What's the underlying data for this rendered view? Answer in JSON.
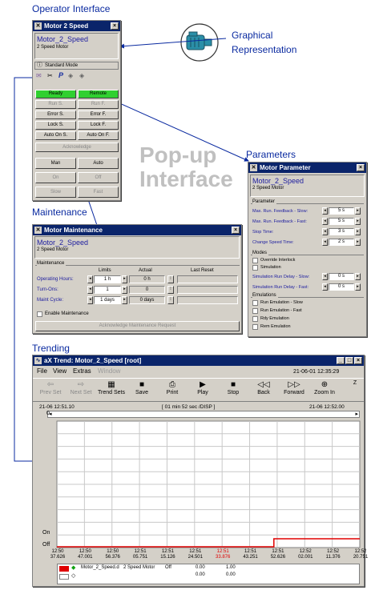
{
  "labels": {
    "operator_interface": "Operator Interface",
    "graphical_representation_1": "Graphical",
    "graphical_representation_2": "Representation",
    "parameters": "Parameters",
    "popup_1": "Pop-up",
    "popup_2": "Interface",
    "maintenance": "Maintenance",
    "trending": "Trending"
  },
  "motor2": {
    "title": "Motor 2 Speed",
    "name": "Motor_2_Speed",
    "desc": "2 Speed Motor",
    "mode": "Standard Mode",
    "toolbar_p": "P",
    "ready": "Ready",
    "remote": "Remote",
    "run_s": "Run S.",
    "run_f": "Run F.",
    "error_s": "Error S.",
    "error_f": "Error F.",
    "lock_s": "Lock S.",
    "lock_f": "Lock F.",
    "auto_on_s": "Auto On S.",
    "auto_on_f": "Auto On F.",
    "acknowledge": "Acknowledge",
    "man": "Man",
    "auto": "Auto",
    "on": "On",
    "off": "Off",
    "slow": "Slow",
    "fast": "Fast"
  },
  "params": {
    "title": "Motor Parameter",
    "name": "Motor_2_Speed",
    "desc": "2 Speed Motor",
    "group_parameter": "Parameter",
    "rows": [
      {
        "label": "Max. Run. Feedback - Slow:",
        "value": "5 s"
      },
      {
        "label": "Max. Run. Feedback - Fast:",
        "value": "5 s"
      },
      {
        "label": "Stop Time:",
        "value": "3 s"
      },
      {
        "label": "Change Speed Time:",
        "value": "2 s"
      }
    ],
    "group_modes": "Modes",
    "mode_items": [
      "Override Interlock",
      "Simulation"
    ],
    "sim_rows": [
      {
        "label": "Simulation Run Delay - Slow:",
        "value": "0 s"
      },
      {
        "label": "Simulation Run Delay - Fast:",
        "value": "0 s"
      }
    ],
    "group_emulations": "Emulations",
    "emu_items": [
      "Run Emulation - Slow",
      "Run Emulation - Fast",
      "Rdy Emulation",
      "Rem Emulation"
    ]
  },
  "maint": {
    "title": "Motor Maintenance",
    "name": "Motor_2_Speed",
    "desc": "2 Speed Motor",
    "group": "Maintenance",
    "col_limits": "Limits",
    "col_actual": "Actual",
    "col_last_reset": "Last Reset",
    "rows": [
      {
        "label": "Operating Hours:",
        "limit": "1 h",
        "actual": "0 h"
      },
      {
        "label": "Turn-Ons:",
        "limit": "1",
        "actual": "0"
      },
      {
        "label": "Maint Cycle:",
        "limit": "1 days",
        "actual": "0 days"
      }
    ],
    "enable": "Enable Maintenance",
    "ack": "Acknowledge Maintenance Request"
  },
  "trend": {
    "title": "aX Trend: Motor_2_Speed [root]",
    "menu": [
      "File",
      "View",
      "Extras",
      "Window"
    ],
    "datetime": "21-06-01 12:35:29",
    "tools": [
      {
        "label": "Prev Set",
        "glyph": "⇦"
      },
      {
        "label": "Next Set",
        "glyph": "⇨"
      },
      {
        "label": "Trend Sets",
        "glyph": "▦"
      },
      {
        "label": "Save",
        "glyph": "■"
      },
      {
        "label": "Print",
        "glyph": "⎙"
      },
      {
        "label": "Play",
        "glyph": "▶"
      },
      {
        "label": "Stop",
        "glyph": "■"
      },
      {
        "label": "Back",
        "glyph": "◁◁"
      },
      {
        "label": "Forward",
        "glyph": "▷▷"
      },
      {
        "label": "Zoom In",
        "glyph": "⊕"
      },
      {
        "label": "Z",
        "glyph": ""
      }
    ],
    "range_start": "21-06 12:51.10",
    "range_span": "[ 01 min 52 sec /DISP ]",
    "range_end": "21-06 12:52.00",
    "y_mark": "0",
    "y_on": "On",
    "y_off": "Off",
    "x_ticks": [
      {
        "t1": "12:50",
        "t2": "37.626",
        "red": false
      },
      {
        "t1": "12:50",
        "t2": "47.001",
        "red": false
      },
      {
        "t1": "12:50",
        "t2": "56.376",
        "red": false
      },
      {
        "t1": "12:51",
        "t2": "05.751",
        "red": false
      },
      {
        "t1": "12:51",
        "t2": "15.126",
        "red": false
      },
      {
        "t1": "12:51",
        "t2": "24.501",
        "red": false
      },
      {
        "t1": "12:51",
        "t2": "33.876",
        "red": true
      },
      {
        "t1": "12:51",
        "t2": "43.251",
        "red": false
      },
      {
        "t1": "12:51",
        "t2": "52.626",
        "red": false
      },
      {
        "t1": "12:52",
        "t2": "02.001",
        "red": false
      },
      {
        "t1": "12:52",
        "t2": "11.376",
        "red": false
      },
      {
        "t1": "12:52",
        "t2": "20.751",
        "red": false
      }
    ],
    "legend": {
      "name": "Motor_2_Speed.d",
      "desc": "2 Speed Motor",
      "value": "Off",
      "min1": "0.00",
      "max1": "1.00",
      "min2": "0.00",
      "max2": "0.00"
    },
    "colors": {
      "signal": "#e00000"
    }
  }
}
